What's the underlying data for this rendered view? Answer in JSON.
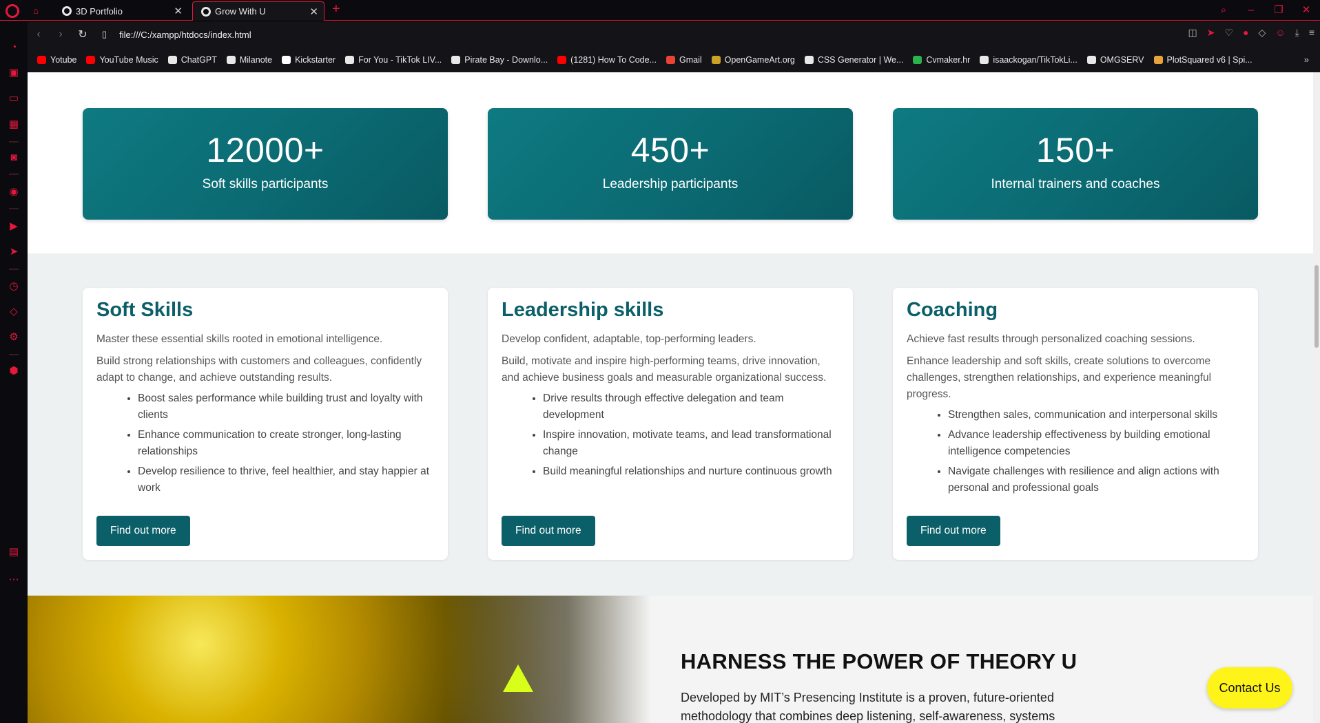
{
  "browser": {
    "tabs": [
      {
        "title": "3D Portfolio"
      },
      {
        "title": "Grow With U"
      }
    ],
    "url": "file:///C:/xampp/htdocs/index.html",
    "bookmarks": [
      {
        "label": "Yotube",
        "icon": "youtube-icon",
        "color": "#ff0000"
      },
      {
        "label": "YouTube Music",
        "icon": "youtube-music-icon",
        "color": "#ff0000"
      },
      {
        "label": "ChatGPT",
        "icon": "chatgpt-icon",
        "color": "#e8e8e8"
      },
      {
        "label": "Milanote",
        "icon": "milanote-icon",
        "color": "#e8e8e8"
      },
      {
        "label": "Kickstarter",
        "icon": "kickstarter-icon",
        "color": "#ffffff"
      },
      {
        "label": "For You - TikTok LIV...",
        "icon": "tiktok-icon",
        "color": "#e8e8e8"
      },
      {
        "label": "Pirate Bay - Downlo...",
        "icon": "piratebay-icon",
        "color": "#e8e8e8"
      },
      {
        "label": "(1281) How To Code...",
        "icon": "youtube-icon",
        "color": "#ff0000"
      },
      {
        "label": "Gmail",
        "icon": "gmail-icon",
        "color": "#ea4335"
      },
      {
        "label": "OpenGameArt.org",
        "icon": "opengameart-icon",
        "color": "#c9a227"
      },
      {
        "label": "CSS Generator | We...",
        "icon": "code-icon",
        "color": "#e8e8e8"
      },
      {
        "label": "Cvmaker.hr",
        "icon": "cvmaker-icon",
        "color": "#2bb24c"
      },
      {
        "label": "isaackogan/TikTokLi...",
        "icon": "github-icon",
        "color": "#e8e8e8"
      },
      {
        "label": "OMGSERV",
        "icon": "omgserv-icon",
        "color": "#e8e8e8"
      },
      {
        "label": "PlotSquared v6 | Spi...",
        "icon": "spigot-icon",
        "color": "#e8a33d"
      }
    ]
  },
  "stats": [
    {
      "value": "12000+",
      "label": "Soft skills participants"
    },
    {
      "value": "450+",
      "label": "Leadership participants"
    },
    {
      "value": "150+",
      "label": "Internal trainers and coaches"
    }
  ],
  "cards": [
    {
      "title": "Soft Skills",
      "intro": "Master these essential skills rooted in emotional intelligence.",
      "body": "Build strong relationships with customers and colleagues, confidently adapt to change, and achieve outstanding results.",
      "bullets": [
        "Boost sales performance while building trust and loyalty with clients",
        "Enhance communication to create stronger, long-lasting relationships",
        "Develop resilience to thrive, feel healthier, and stay happier at work"
      ],
      "button": "Find out more"
    },
    {
      "title": "Leadership skills",
      "intro": "Develop confident, adaptable, top-performing leaders.",
      "body": "Build, motivate and inspire high-performing teams, drive innovation, and achieve business goals and measurable organizational success.",
      "bullets": [
        "Drive results through effective delegation and team development",
        "Inspire innovation, motivate teams, and lead transformational change",
        "Build meaningful relationships and nurture continuous growth"
      ],
      "button": "Find out more"
    },
    {
      "title": "Coaching",
      "intro": "Achieve fast results through personalized coaching sessions.",
      "body": "Enhance leadership and soft skills, create solutions to overcome challenges, strengthen relationships, and experience meaningful progress.",
      "bullets": [
        "Strengthen sales, communication and interpersonal skills",
        "Advance leadership effectiveness by building emotional intelligence competencies",
        "Navigate challenges with resilience and align actions with personal and professional goals"
      ],
      "button": "Find out more"
    }
  ],
  "theory": {
    "heading": "HARNESS THE POWER OF THEORY U",
    "text": "Developed by MIT’s Presencing Institute is a proven, future-oriented methodology that combines deep listening, self-awareness, systems"
  },
  "contact_button": "Contact Us",
  "colors": {
    "accent": "#e6173d",
    "teal": "#0b5f69",
    "contact": "#fff41a"
  }
}
